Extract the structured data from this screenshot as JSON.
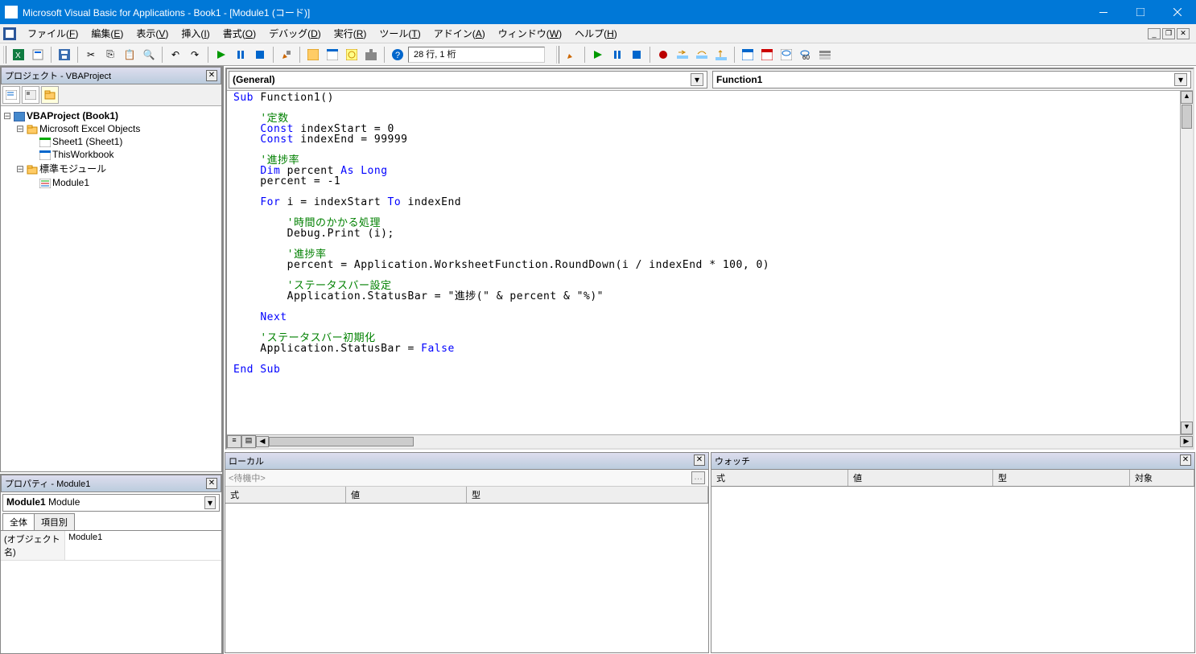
{
  "title": "Microsoft Visual Basic for Applications - Book1 - [Module1 (コード)]",
  "menus": [
    "ファイル(F)",
    "編集(E)",
    "表示(V)",
    "挿入(I)",
    "書式(O)",
    "デバッグ(D)",
    "実行(R)",
    "ツール(T)",
    "アドイン(A)",
    "ウィンドウ(W)",
    "ヘルプ(H)"
  ],
  "toolbar_pos": "28 行, 1 桁",
  "project": {
    "title": "プロジェクト - VBAProject",
    "root": "VBAProject (Book1)",
    "folder1": "Microsoft Excel Objects",
    "sheet": "Sheet1 (Sheet1)",
    "wb": "ThisWorkbook",
    "folder2": "標準モジュール",
    "module": "Module1"
  },
  "properties": {
    "title": "プロパティ - Module1",
    "combo_bold": "Module1",
    "combo_rest": " Module",
    "tabs": [
      "全体",
      "項目別"
    ],
    "row_k": "(オブジェクト名)",
    "row_v": "Module1"
  },
  "code_combo_left": "(General)",
  "code_combo_right": "Function1",
  "locals": {
    "title": "ローカル",
    "status": "<待機中>",
    "cols": [
      "式",
      "値",
      "型"
    ]
  },
  "watch": {
    "title": "ウォッチ",
    "cols": [
      "式",
      "値",
      "型",
      "対象"
    ]
  },
  "code_lines": [
    {
      "i": 0,
      "t": [
        [
          "kw-blue",
          "Sub "
        ],
        [
          "",
          "Function1()"
        ]
      ]
    },
    {
      "i": 0,
      "t": [
        [
          "",
          ""
        ]
      ]
    },
    {
      "i": 1,
      "t": [
        [
          "kw-green",
          "'定数"
        ]
      ]
    },
    {
      "i": 1,
      "t": [
        [
          "kw-blue",
          "Const "
        ],
        [
          "",
          "indexStart = 0"
        ]
      ]
    },
    {
      "i": 1,
      "t": [
        [
          "kw-blue",
          "Const "
        ],
        [
          "",
          "indexEnd = 99999"
        ]
      ]
    },
    {
      "i": 0,
      "t": [
        [
          "",
          ""
        ]
      ]
    },
    {
      "i": 1,
      "t": [
        [
          "kw-green",
          "'進捗率"
        ]
      ]
    },
    {
      "i": 1,
      "t": [
        [
          "kw-blue",
          "Dim "
        ],
        [
          "",
          "percent "
        ],
        [
          "kw-blue",
          "As Long"
        ]
      ]
    },
    {
      "i": 1,
      "t": [
        [
          "",
          "percent = -1"
        ]
      ]
    },
    {
      "i": 0,
      "t": [
        [
          "",
          ""
        ]
      ]
    },
    {
      "i": 1,
      "t": [
        [
          "kw-blue",
          "For "
        ],
        [
          "",
          "i = indexStart "
        ],
        [
          "kw-blue",
          "To "
        ],
        [
          "",
          "indexEnd"
        ]
      ]
    },
    {
      "i": 0,
      "t": [
        [
          "",
          ""
        ]
      ]
    },
    {
      "i": 2,
      "t": [
        [
          "kw-green",
          "'時間のかかる処理"
        ]
      ]
    },
    {
      "i": 2,
      "t": [
        [
          "",
          "Debug.Print (i);"
        ]
      ]
    },
    {
      "i": 0,
      "t": [
        [
          "",
          ""
        ]
      ]
    },
    {
      "i": 2,
      "t": [
        [
          "kw-green",
          "'進捗率"
        ]
      ]
    },
    {
      "i": 2,
      "t": [
        [
          "",
          "percent = Application.WorksheetFunction.RoundDown(i / indexEnd * 100, 0)"
        ]
      ]
    },
    {
      "i": 0,
      "t": [
        [
          "",
          ""
        ]
      ]
    },
    {
      "i": 2,
      "t": [
        [
          "kw-green",
          "'ステータスバー設定"
        ]
      ]
    },
    {
      "i": 2,
      "t": [
        [
          "",
          "Application.StatusBar = \"進捗(\" & percent & \"%)\""
        ]
      ]
    },
    {
      "i": 0,
      "t": [
        [
          "",
          ""
        ]
      ]
    },
    {
      "i": 1,
      "t": [
        [
          "kw-blue",
          "Next"
        ]
      ]
    },
    {
      "i": 0,
      "t": [
        [
          "",
          ""
        ]
      ]
    },
    {
      "i": 1,
      "t": [
        [
          "kw-green",
          "'ステータスバー初期化"
        ]
      ]
    },
    {
      "i": 1,
      "t": [
        [
          "",
          "Application.StatusBar = "
        ],
        [
          "kw-blue",
          "False"
        ]
      ]
    },
    {
      "i": 0,
      "t": [
        [
          "",
          ""
        ]
      ]
    },
    {
      "i": 0,
      "t": [
        [
          "kw-blue",
          "End Sub"
        ]
      ]
    }
  ]
}
